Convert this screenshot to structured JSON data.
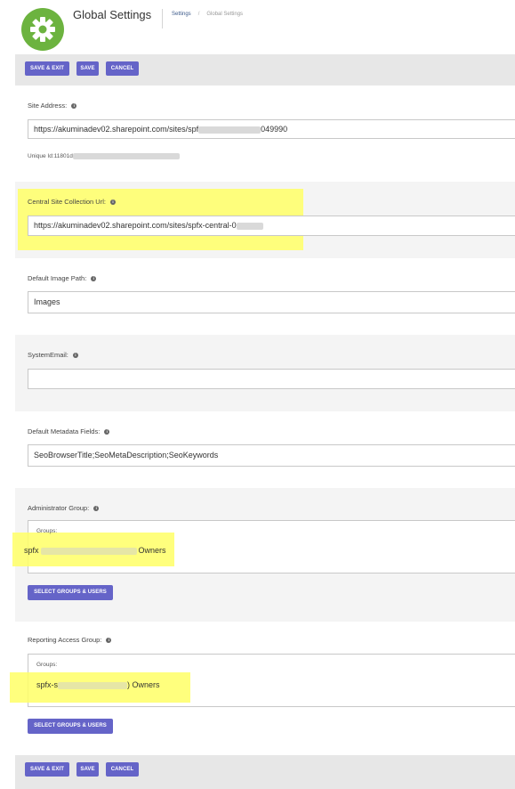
{
  "header": {
    "title": "Global Settings",
    "breadcrumb": {
      "link": "Settings",
      "separator": "/",
      "current": "Global Settings"
    }
  },
  "toolbar": {
    "save_exit": "SAVE & EXIT",
    "save": "SAVE",
    "cancel": "CANCEL"
  },
  "info_glyph": "i",
  "site_address": {
    "label": "Site Address:",
    "value_prefix": "https://akuminadev02.sharepoint.com/sites/spf",
    "value_suffix": "049990",
    "unique_id_prefix": "Unique Id:11801d"
  },
  "central_site": {
    "label": "Central Site Collection Url:",
    "value_prefix": "https://akuminadev02.sharepoint.com/sites/spfx-central-0"
  },
  "default_image_path": {
    "label": "Default Image Path:",
    "value": "Images"
  },
  "system_email": {
    "label": "SystemEmail:",
    "value": ""
  },
  "default_metadata": {
    "label": "Default Metadata Fields:",
    "value": "SeoBrowserTitle;SeoMetaDescription;SeoKeywords"
  },
  "admin_group": {
    "label": "Administrator Group:",
    "groups_label": "Groups:",
    "group_prefix": "spfx",
    "group_suffix": "Owners",
    "button": "SELECT GROUPS & USERS"
  },
  "reporting_group": {
    "label": "Reporting Access Group:",
    "groups_label": "Groups:",
    "group_prefix": "spfx-s",
    "group_suffix": ") Owners",
    "button": "SELECT GROUPS & USERS"
  },
  "colors": {
    "accent": "#6564c8",
    "highlight": "#ffff66",
    "logo": "#6cb33f"
  }
}
